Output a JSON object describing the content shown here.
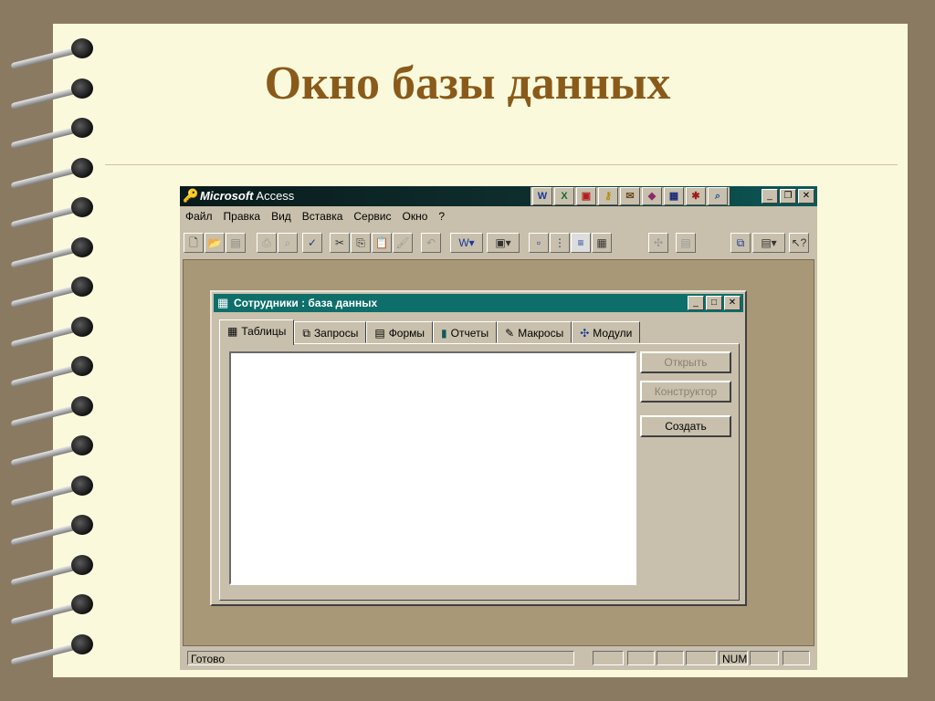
{
  "slide": {
    "title": "Окно базы данных"
  },
  "app": {
    "title_brand": "Microsoft",
    "title_name": "Access",
    "menu": [
      "Файл",
      "Правка",
      "Вид",
      "Вставка",
      "Сервис",
      "Окно",
      "?"
    ],
    "office_icons": [
      "word-icon",
      "excel-icon",
      "powerpoint-icon",
      "key-icon",
      "mail-icon",
      "book-icon",
      "schedule-icon",
      "binder-icon",
      "find-icon"
    ],
    "status": {
      "ready": "Готово",
      "num": "NUM"
    }
  },
  "dbwindow": {
    "title": "Сотрудники : база данных",
    "tabs": [
      "Таблицы",
      "Запросы",
      "Формы",
      "Отчеты",
      "Макросы",
      "Модули"
    ],
    "active_tab": "Таблицы",
    "buttons": {
      "open": "Открыть",
      "design": "Конструктор",
      "create": "Создать"
    }
  },
  "colors": {
    "title_text": "#8a5a1a",
    "db_titlebar": "#0e6e6a",
    "workspace": "#a89878"
  }
}
